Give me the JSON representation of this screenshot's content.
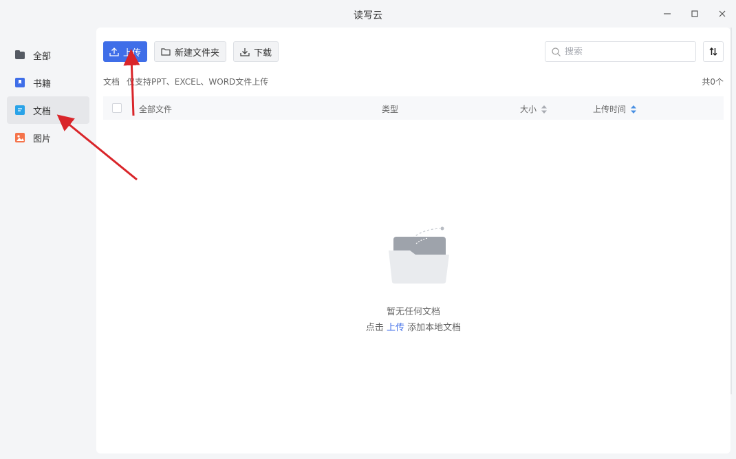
{
  "window": {
    "title": "读写云"
  },
  "sidebar": {
    "items": [
      {
        "label": "全部",
        "icon": "all-icon",
        "color": "#555a63"
      },
      {
        "label": "书籍",
        "icon": "book-icon",
        "color": "#3f6ee8"
      },
      {
        "label": "文档",
        "icon": "document-icon",
        "color": "#2aa3e8",
        "active": true
      },
      {
        "label": "图片",
        "icon": "image-icon",
        "color": "#f5734a"
      }
    ]
  },
  "toolbar": {
    "upload_label": "上传",
    "new_folder_label": "新建文件夹",
    "download_label": "下载",
    "search_placeholder": "搜索",
    "accent": "#3f6ee8"
  },
  "hint": {
    "category": "文档",
    "text": "仅支持PPT、EXCEL、WORD文件上传",
    "count": "共0个"
  },
  "table": {
    "columns": [
      "全部文件",
      "类型",
      "大小",
      "上传时间"
    ]
  },
  "empty": {
    "title": "暂无任何文档",
    "prefix": "点击",
    "link": "上传",
    "suffix": "添加本地文档"
  },
  "annotations": {
    "arrow_color": "#d9252a"
  }
}
